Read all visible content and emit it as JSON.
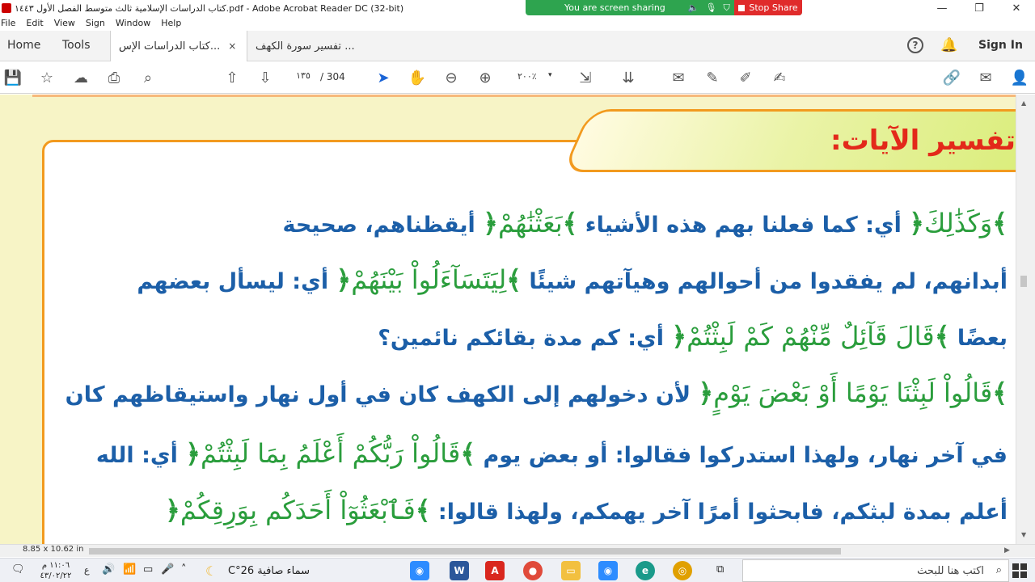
{
  "window": {
    "title": "كتاب الدراسات الإسلامية ثالث متوسط الفصل الأول ١٤٤٣.pdf - Adobe Acrobat Reader DC (32-bit)",
    "share_text": "You are screen sharing",
    "stop_share": "Stop Share"
  },
  "menu": [
    "File",
    "Edit",
    "View",
    "Sign",
    "Window",
    "Help"
  ],
  "tabs": {
    "home": "Home",
    "tools": "Tools",
    "doc_active": "كتاب الدراسات الإس...",
    "doc_inactive": "تفسير سورة الكهف ...",
    "close": "×",
    "sign_in": "Sign In",
    "help": "?"
  },
  "toolbar": {
    "page_current": "١٣٥",
    "page_total": "/ 304",
    "zoom": "٢٠٠٪",
    "zoom_arrow": "▾"
  },
  "document": {
    "heading": "تفسير الآيات:",
    "lines": [
      {
        "plain_a": "وَكَذَٰلِكَ",
        "plain_b": " أي: كما فعلنا بهم هذه الأشياء ",
        "quran": "بَعَثْنَٰهُمْ",
        "plain_c": " أيقظناهم، صحيحة"
      },
      {
        "plain_a": "أبدانهم، لم يفقدوا من أحوالهم وهيآتهم شيئًا ",
        "quran": "لِيَتَسَآءَلُواْ بَيْنَهُمْ",
        "plain_c": " أي: ليسأل بعضهم"
      },
      {
        "plain_a": "بعضًا ",
        "quran": "قَالَ قَآئِلٌ مِّنْهُمْ كَمْ لَبِثْتُمْ",
        "plain_c": " أي: كم مدة بقائكم نائمين؟"
      },
      {
        "quran": "قَالُواْ لَبِثْنَا يَوْمًا أَوْ بَعْضَ يَوْمٍ",
        "plain_c": " لأن دخولهم إلى الكهف كان في أول نهار واستيقاظهم كان"
      },
      {
        "plain_a": "في آخر نهار، ولهذا استدركوا فقالوا: أو بعض يوم ",
        "quran": "قَالُواْ رَبُّكُمْ أَعْلَمُ بِمَا لَبِثْتُمْ",
        "plain_c": " أي: الله"
      },
      {
        "plain_a": "أعلم بمدة لبثكم، فابحثوا أمرًا آخر يهمكم، ولهذا قالوا: ",
        "quran": "فَٱبْعَثُوٓاْ أَحَدَكُم بِوَرِقِكُمْ"
      }
    ],
    "page_size": "8.85 x 10.62 in"
  },
  "taskbar": {
    "time": "١١:٠٦ م",
    "date": "٤٣/٠٢/٢٢",
    "lang": "ع",
    "weather": "سماء صافية  26°C",
    "search_placeholder": "اكتب هنا للبحث"
  },
  "colors": {
    "heading_red": "#e3291a",
    "text_blue": "#1c5fa8",
    "quran_green": "#2a9d3c",
    "frame_orange": "#f29a1e",
    "page_bg": "#f7f4c6"
  }
}
